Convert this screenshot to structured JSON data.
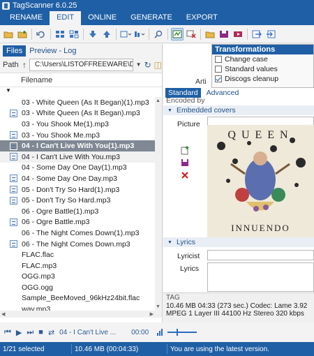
{
  "window": {
    "title": "TagScanner 6.0.25"
  },
  "menu": {
    "items": [
      "RENAME",
      "EDIT",
      "ONLINE",
      "GENERATE",
      "EXPORT"
    ],
    "active": "EDIT"
  },
  "toolbar": {
    "active_button": "cleanup-icon"
  },
  "left_panel": {
    "tabs": [
      "Files",
      "Preview - Log"
    ],
    "active_tab": "Files",
    "path_label": "Path",
    "path_value": "C:\\Users\\LISTOFFREEWARE\\Desktop\\",
    "column_header": "Filename"
  },
  "files": [
    {
      "name": "03 - White Queen (As It Began)(1).mp3",
      "checked": false
    },
    {
      "name": "03 - White Queen (As It Began).mp3",
      "checked": true
    },
    {
      "name": "03 - You Shook Me(1).mp3",
      "checked": false
    },
    {
      "name": "03 - You Shook Me.mp3",
      "checked": true
    },
    {
      "name": "04 - I Can't Live With You(1).mp3",
      "checked": false,
      "selected": true
    },
    {
      "name": "04 - I Can't Live With You.mp3",
      "checked": true
    },
    {
      "name": "04 - Some Day One Day(1).mp3",
      "checked": false
    },
    {
      "name": "04 - Some Day One Day.mp3",
      "checked": true
    },
    {
      "name": "05 - Don't Try So Hard(1).mp3",
      "checked": true
    },
    {
      "name": "05 - Don't Try So Hard.mp3",
      "checked": true
    },
    {
      "name": "06 - Ogre Battle(1).mp3",
      "checked": false
    },
    {
      "name": "06 - Ogre Battle.mp3",
      "checked": true
    },
    {
      "name": "06 - The Night Comes Down(1).mp3",
      "checked": false
    },
    {
      "name": "06 - The Night Comes Down.mp3",
      "checked": true
    },
    {
      "name": "FLAC.flac",
      "checked": false
    },
    {
      "name": "FLAC.mp3",
      "checked": false
    },
    {
      "name": "OGG.mp3",
      "checked": false
    },
    {
      "name": "OGG.ogg",
      "checked": false
    },
    {
      "name": "Sample_BeeMoved_96kHz24bit.flac",
      "checked": false
    },
    {
      "name": "wav.mp3",
      "checked": false
    }
  ],
  "transformations": {
    "title": "Transformations",
    "items": [
      {
        "label": "Change case",
        "checked": false
      },
      {
        "label": "Standard values",
        "checked": false
      },
      {
        "label": "Discogs cleanup",
        "checked": true
      }
    ]
  },
  "editor": {
    "tabs": [
      "Standard",
      "Advanced"
    ],
    "active_tab": "Standard",
    "column_cut": "Arti",
    "encoded_by_label": "Encoded by",
    "embedded_covers_label": "Embedded covers",
    "picture_label": "Picture",
    "lyrics_section": "Lyrics",
    "lyricist_label": "Lyricist",
    "lyrics_label": "Lyrics"
  },
  "cover_art": {
    "band": "QUEEN",
    "album": "INNUENDO"
  },
  "tag_info": {
    "title": "TAG",
    "line1": "10.46 MB  04:33 (273 sec.)  Codec: Lame 3.92",
    "line2": "MPEG 1 Layer III  44100 Hz  Stereo  320 kbps"
  },
  "player": {
    "now_playing": "04 - I Can't Live ...",
    "time": "00:00",
    "volume_level": 0.33
  },
  "status": {
    "selected": "1/21 selected",
    "size": "10.46 MB (00:04:33)",
    "message": "You are using the latest version."
  }
}
